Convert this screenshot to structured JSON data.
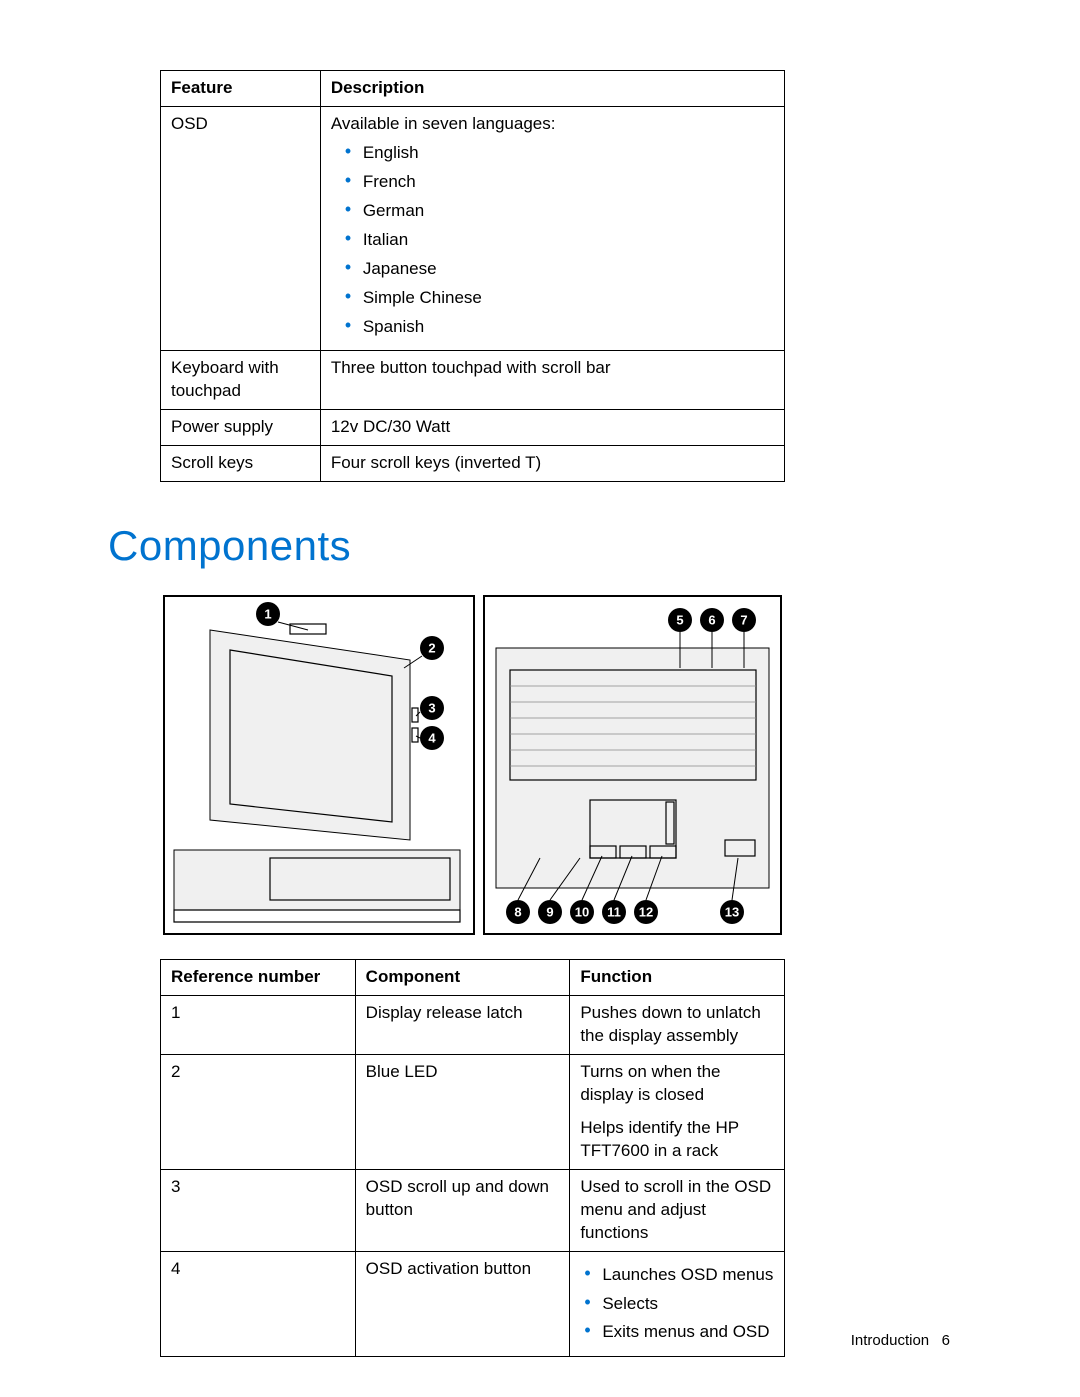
{
  "features_table": {
    "headers": [
      "Feature",
      "Description"
    ],
    "rows": {
      "osd": {
        "feature": "OSD",
        "desc_intro": "Available in seven languages:",
        "langs": [
          "English",
          "French",
          "German",
          "Italian",
          "Japanese",
          "Simple Chinese",
          "Spanish"
        ]
      },
      "keyboard": {
        "feature": "Keyboard with touchpad",
        "desc": "Three button touchpad with scroll bar"
      },
      "power": {
        "feature": "Power supply",
        "desc": "12v DC/30 Watt"
      },
      "scroll": {
        "feature": "Scroll keys",
        "desc": "Four scroll keys (inverted T)"
      }
    }
  },
  "section_title": "Components",
  "diagram": {
    "callouts_left": [
      "1",
      "2",
      "3",
      "4"
    ],
    "callouts_top_right": [
      "5",
      "6",
      "7"
    ],
    "callouts_bottom_right": [
      "8",
      "9",
      "10",
      "11",
      "12",
      "13"
    ]
  },
  "components_table": {
    "headers": [
      "Reference number",
      "Component",
      "Function"
    ],
    "rows": {
      "r1": {
        "ref": "1",
        "component": "Display release latch",
        "function": "Pushes down to unlatch the display assembly"
      },
      "r2": {
        "ref": "2",
        "component": "Blue LED",
        "function_a": "Turns on when the display is closed",
        "function_b": "Helps identify the HP TFT7600 in a rack"
      },
      "r3": {
        "ref": "3",
        "component": "OSD scroll up and down button",
        "function": "Used to scroll in the OSD menu and adjust functions"
      },
      "r4": {
        "ref": "4",
        "component": "OSD activation button",
        "bullets": [
          "Launches OSD menus",
          "Selects",
          "Exits menus and OSD"
        ]
      }
    }
  },
  "footer": {
    "section": "Introduction",
    "page": "6"
  }
}
